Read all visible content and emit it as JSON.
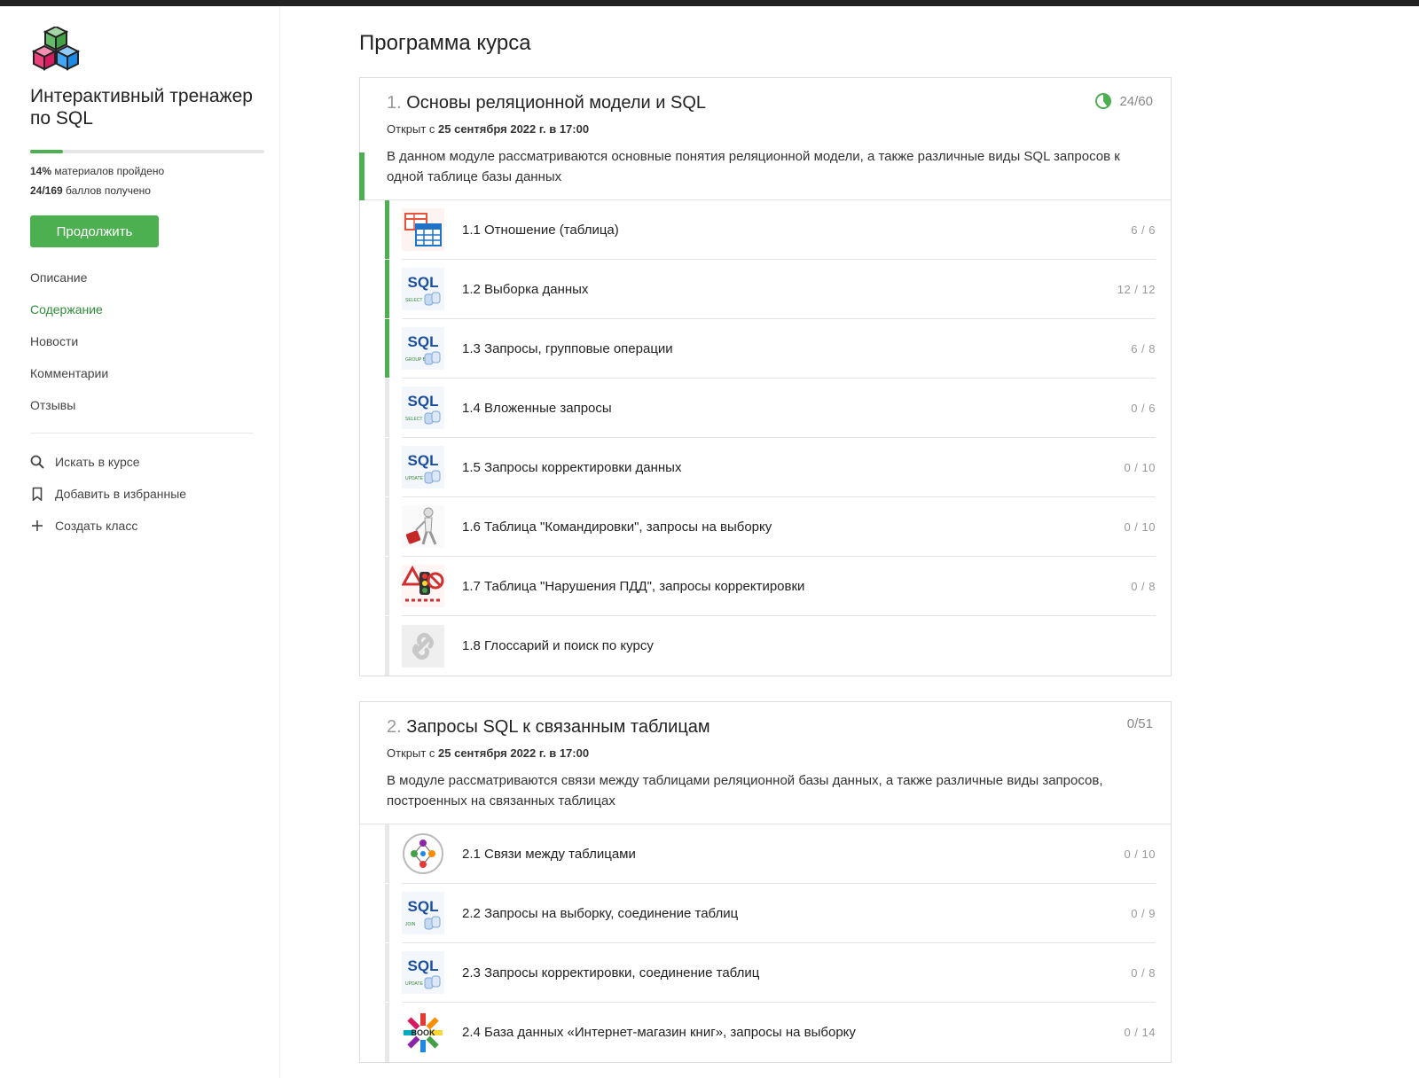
{
  "sidebar": {
    "course_title": "Интерактивный тренажер по SQL",
    "progress_percent": 14,
    "materials_percent": "14%",
    "materials_label": " материалов пройдено",
    "points_value": "24/169",
    "points_label": " баллов получено",
    "continue_label": "Продолжить",
    "nav": [
      {
        "label": "Описание"
      },
      {
        "label": "Содержание"
      },
      {
        "label": "Новости"
      },
      {
        "label": "Комментарии"
      },
      {
        "label": "Отзывы"
      }
    ],
    "actions": [
      {
        "label": "Искать в курсе",
        "icon": "search-icon"
      },
      {
        "label": "Добавить в избранные",
        "icon": "bookmark-icon"
      },
      {
        "label": "Создать класс",
        "icon": "plus-icon"
      }
    ]
  },
  "main": {
    "page_title": "Программа курса",
    "modules": [
      {
        "num": "1.",
        "title": "Основы реляционной модели и SQL",
        "score": "24/60",
        "progress_fraction": 0.4,
        "opened_prefix": "Открыт с ",
        "opened_date": "25 сентября 2022 г. в 17:00",
        "description": "В данном модуле рассматриваются основные понятия реляционной модели, а также различные виды SQL запросов к одной таблице базы данных",
        "lessons": [
          {
            "title": "1.1 Отношение (таблица)",
            "score": "6 / 6",
            "icon": "table-icon",
            "status": "done"
          },
          {
            "title": "1.2 Выборка данных",
            "score": "12 / 12",
            "icon": "sql-select-icon",
            "status": "done"
          },
          {
            "title": "1.3 Запросы, групповые операции",
            "score": "6 / 8",
            "icon": "sql-group-icon",
            "status": "done"
          },
          {
            "title": "1.4 Вложенные запросы",
            "score": "0 / 6",
            "icon": "sql-nested-icon",
            "status": "none"
          },
          {
            "title": "1.5 Запросы корректировки данных",
            "score": "0 / 10",
            "icon": "sql-update-icon",
            "status": "none"
          },
          {
            "title": "1.6 Таблица \"Командировки\", запросы на выборку",
            "score": "0 / 10",
            "icon": "traveler-icon",
            "status": "none"
          },
          {
            "title": "1.7 Таблица \"Нарушения ПДД\", запросы корректировки",
            "score": "0 / 8",
            "icon": "traffic-icon",
            "status": "none"
          },
          {
            "title": "1.8 Глоссарий и поиск по курсу",
            "score": "",
            "icon": "link-icon",
            "status": "none"
          }
        ]
      },
      {
        "num": "2.",
        "title": "Запросы SQL к связанным таблицам",
        "score": "0/51",
        "progress_fraction": 0,
        "opened_prefix": "Открыт с ",
        "opened_date": "25 сентября 2022 г. в 17:00",
        "description": "В модуле рассматриваются связи между таблицами реляционной базы данных, а также различные виды запросов, построенных на связанных таблицах",
        "lessons": [
          {
            "title": "2.1 Связи между таблицами",
            "score": "0 / 10",
            "icon": "relations-icon",
            "status": "none"
          },
          {
            "title": "2.2 Запросы на выборку, соединение таблиц",
            "score": "0 / 9",
            "icon": "sql-join-icon",
            "status": "none"
          },
          {
            "title": "2.3 Запросы корректировки, соединение таблиц",
            "score": "0 / 8",
            "icon": "sql-update-join-icon",
            "status": "none"
          },
          {
            "title": "2.4 База данных «Интернет-магазин книг», запросы на выборку",
            "score": "0 / 14",
            "icon": "book-icon",
            "status": "none"
          }
        ]
      }
    ]
  },
  "colors": {
    "accent": "#4caf50",
    "active_nav": "#2e8b36"
  }
}
